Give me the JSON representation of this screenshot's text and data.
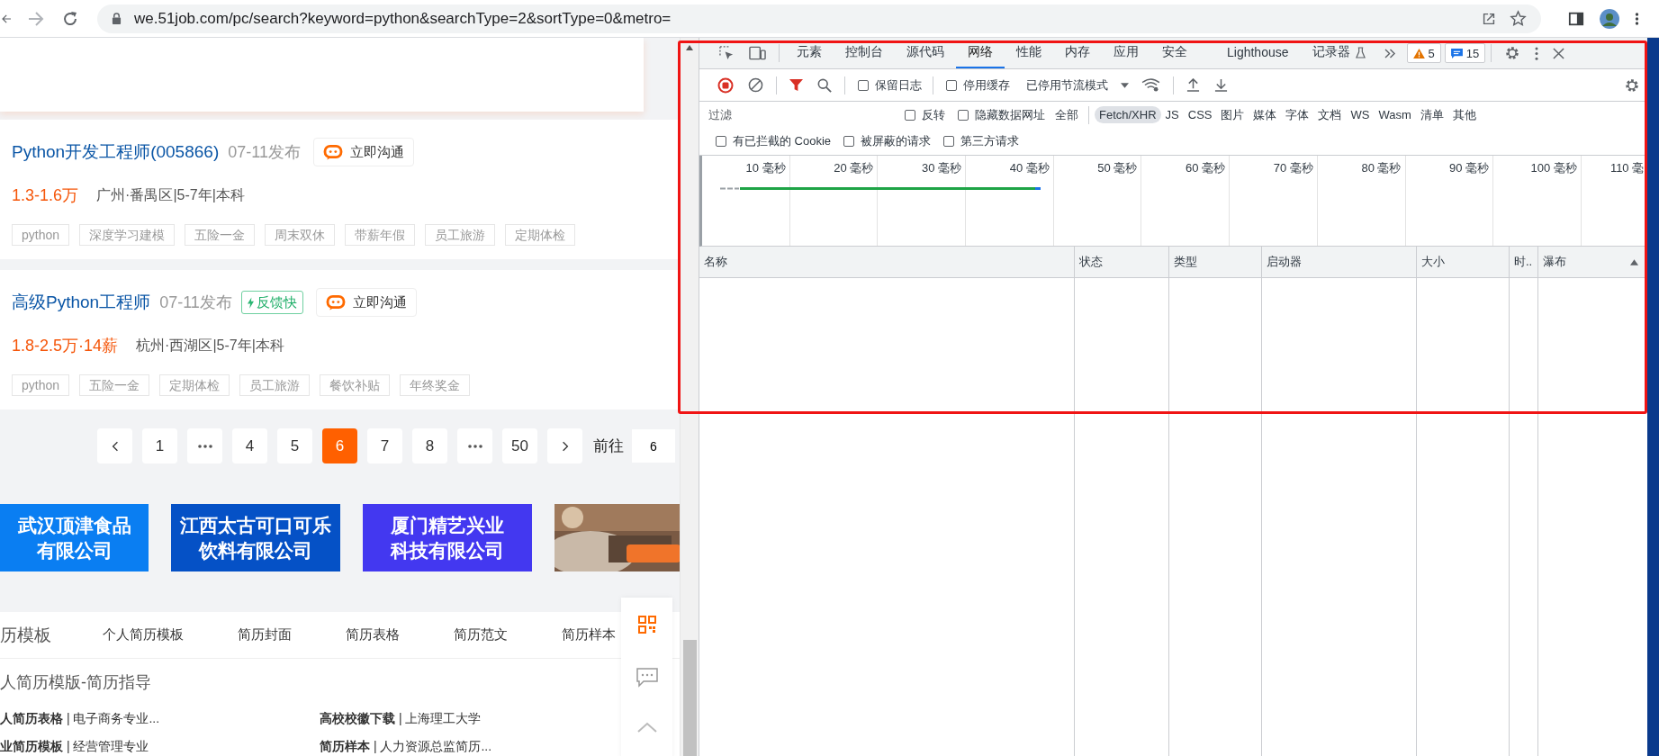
{
  "browser": {
    "url": "we.51job.com/pc/search?keyword=python&searchType=2&sortType=0&metro="
  },
  "jobs": [
    {
      "title": "Python开发工程师(005866)",
      "date": "07-11发布",
      "chat": "立即沟通",
      "salary": "1.3-1.6万",
      "meta": "广州·番禺区|5-7年|本科",
      "tags": [
        "python",
        "深度学习建模",
        "五险一金",
        "周末双休",
        "带薪年假",
        "员工旅游",
        "定期体检"
      ]
    },
    {
      "title": "高级Python工程师",
      "date": "07-11发布",
      "badge": "反馈快",
      "chat": "立即沟通",
      "salary": "1.8-2.5万·14薪",
      "meta": "杭州·西湖区|5-7年|本科",
      "tags": [
        "python",
        "五险一金",
        "定期体检",
        "员工旅游",
        "餐饮补贴",
        "年终奖金"
      ]
    }
  ],
  "pagination": {
    "items": [
      {
        "kind": "prev",
        "selected": false
      },
      {
        "kind": "page",
        "label": "1",
        "selected": false
      },
      {
        "kind": "more",
        "selected": false
      },
      {
        "kind": "page",
        "label": "4",
        "selected": false
      },
      {
        "kind": "page",
        "label": "5",
        "selected": false
      },
      {
        "kind": "page",
        "label": "6",
        "selected": true
      },
      {
        "kind": "page",
        "label": "7",
        "selected": false
      },
      {
        "kind": "page",
        "label": "8",
        "selected": false
      },
      {
        "kind": "more",
        "selected": false
      },
      {
        "kind": "page",
        "label": "50",
        "selected": false
      },
      {
        "kind": "next",
        "selected": false
      }
    ],
    "goto_label": "前往",
    "goto_value": "6"
  },
  "banners": [
    {
      "kind": "text",
      "lines": [
        "武汉顶津食品",
        "有限公司"
      ],
      "color": "#0a7ef2"
    },
    {
      "kind": "text",
      "lines": [
        "江西太古可口可乐",
        "饮料有限公司"
      ],
      "color": "#0551c6"
    },
    {
      "kind": "text",
      "lines": [
        "厦门精艺兴业",
        "科技有限公司"
      ],
      "color": "#4338f0"
    },
    {
      "kind": "picture"
    }
  ],
  "resume": {
    "title": "历模板",
    "nav": [
      "个人简历模板",
      "简历封面",
      "简历表格",
      "简历范文",
      "简历样本"
    ],
    "heading": "人简历模版-简历指导",
    "links": [
      "**人简历表格** | 电子商务专业...",
      "**高校校徽下载** | 上海理工大学",
      "**业简历模板** | 经营管理专业",
      "**简历样本** | 人力资源总监简历..."
    ]
  },
  "devtools": {
    "tabs": [
      {
        "label": "元素",
        "selected": false,
        "experimental": false
      },
      {
        "label": "控制台",
        "selected": false,
        "experimental": false
      },
      {
        "label": "源代码",
        "selected": false,
        "experimental": false
      },
      {
        "label": "网络",
        "selected": true,
        "experimental": false
      },
      {
        "label": "性能",
        "selected": false,
        "experimental": false
      },
      {
        "label": "内存",
        "selected": false,
        "experimental": false
      },
      {
        "label": "应用",
        "selected": false,
        "experimental": false
      },
      {
        "label": "安全",
        "selected": false,
        "experimental": false
      },
      {
        "label": "Lighthouse",
        "selected": false,
        "experimental": false
      },
      {
        "label": "记录器",
        "selected": false,
        "experimental": true
      }
    ],
    "warnings": "5",
    "messages": "15",
    "recording": true,
    "filter_active": true,
    "toolbar_checks": [
      {
        "label": "保留日志",
        "checked": false
      },
      {
        "label": "停用缓存",
        "checked": false
      }
    ],
    "throttle": "已停用节流模式",
    "filter": {
      "placeholder": "过滤"
    },
    "filter_checks": [
      {
        "label": "反转",
        "checked": false
      },
      {
        "label": "隐藏数据网址",
        "checked": false
      }
    ],
    "types": [
      {
        "label": "全部",
        "selected": false
      },
      {
        "label": "Fetch/XHR",
        "selected": true
      },
      {
        "label": "JS",
        "selected": false
      },
      {
        "label": "CSS",
        "selected": false
      },
      {
        "label": "图片",
        "selected": false
      },
      {
        "label": "媒体",
        "selected": false
      },
      {
        "label": "字体",
        "selected": false
      },
      {
        "label": "文档",
        "selected": false
      },
      {
        "label": "WS",
        "selected": false
      },
      {
        "label": "Wasm",
        "selected": false
      },
      {
        "label": "清单",
        "selected": false
      },
      {
        "label": "其他",
        "selected": false
      }
    ],
    "more_checks": [
      {
        "label": "有已拦截的 Cookie",
        "checked": false
      },
      {
        "label": "被屏蔽的请求",
        "checked": false
      },
      {
        "label": "第三方请求",
        "checked": false
      }
    ],
    "ticks": [
      "10 毫秒",
      "20 毫秒",
      "30 毫秒",
      "40 毫秒",
      "50 毫秒",
      "60 毫秒",
      "70 毫秒",
      "80 毫秒",
      "90 毫秒",
      "100 毫秒",
      "110 毫"
    ],
    "columns": [
      {
        "label": "名称",
        "sorted": false
      },
      {
        "label": "状态",
        "sorted": false
      },
      {
        "label": "类型",
        "sorted": false
      },
      {
        "label": "启动器",
        "sorted": false
      },
      {
        "label": "大小",
        "sorted": false
      },
      {
        "label": "时..",
        "sorted": false
      },
      {
        "label": "瀑布",
        "sorted": true
      }
    ]
  }
}
